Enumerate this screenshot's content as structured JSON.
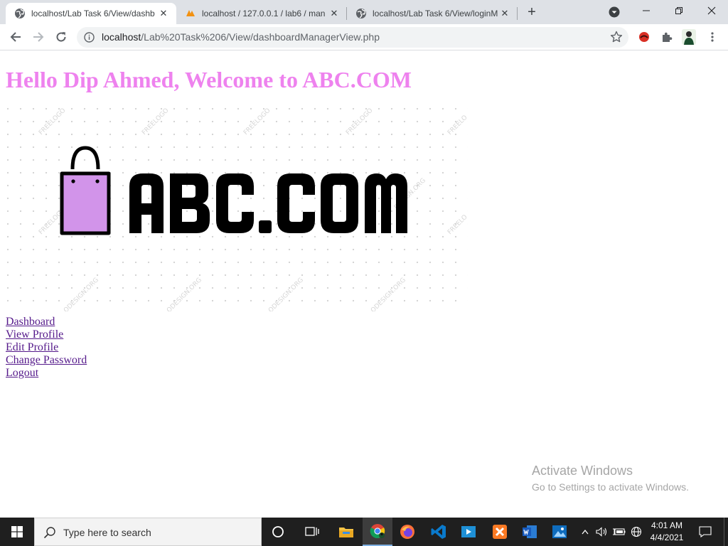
{
  "browser": {
    "tabs": [
      {
        "title": "localhost/Lab Task 6/View/dashb",
        "active": true
      },
      {
        "title": "localhost / 127.0.0.1 / lab6 / man",
        "active": false,
        "favicon_text": "PMA"
      },
      {
        "title": "localhost/Lab Task 6/View/loginM",
        "active": false
      }
    ],
    "url_host": "localhost",
    "url_path": "/Lab%20Task%206/View/dashboardManagerView.php"
  },
  "page": {
    "greeting": "Hello Dip Ahmed, Welcome to ABC.COM",
    "logo_text": "ABC.COM",
    "logo_watermark": "FREELOGODESIGN.ORG",
    "nav_links": [
      "Dashboard",
      "View Profile",
      "Edit Profile",
      "Change Password",
      "Logout"
    ],
    "activate_title": "Activate Windows",
    "activate_subtitle": "Go to Settings to activate Windows."
  },
  "taskbar": {
    "search_placeholder": "Type here to search",
    "time": "4:01 AM",
    "date": "4/4/2021"
  },
  "colors": {
    "greeting": "#ee82ee",
    "link": "#551a8b",
    "bag_fill": "#d294ea",
    "taskbar_bg": "#1f1f1f"
  }
}
